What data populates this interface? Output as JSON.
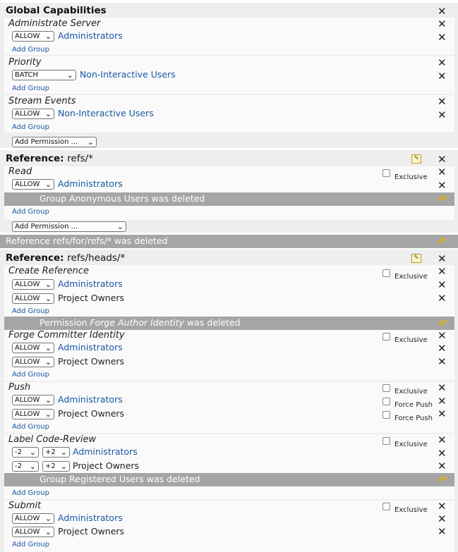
{
  "global": {
    "title": "Global Capabilities",
    "permissions": [
      {
        "name": "Administrate Server",
        "rules": [
          {
            "action": "ALLOW",
            "group": "Administrators"
          }
        ],
        "add_group": "Add Group"
      },
      {
        "name": "Priority",
        "rules": [
          {
            "action": "BATCH",
            "group": "Non-Interactive Users"
          }
        ],
        "add_group": "Add Group"
      },
      {
        "name": "Stream Events",
        "rules": [
          {
            "action": "ALLOW",
            "group": "Non-Interactive Users"
          }
        ],
        "add_group": "Add Group"
      }
    ],
    "add_permission": "Add Permission ..."
  },
  "refs_all": {
    "label": "Reference:",
    "ref": "refs/*",
    "permission": {
      "name": "Read",
      "exclusive_label": "Exclusive",
      "rules": [
        {
          "action": "ALLOW",
          "group": "Administrators"
        }
      ],
      "add_group": "Add Group"
    },
    "deleted_group": "Group Anonymous Users was deleted",
    "add_permission": "Add Permission ..."
  },
  "deleted_reference": "Reference refs/for/refs/* was deleted",
  "refs_heads": {
    "label": "Reference:",
    "ref": "refs/heads/*",
    "create_reference": {
      "name": "Create Reference",
      "exclusive_label": "Exclusive",
      "rules": [
        {
          "action": "ALLOW",
          "group": "Administrators"
        },
        {
          "action": "ALLOW",
          "group": "Project Owners"
        }
      ],
      "add_group": "Add Group"
    },
    "deleted_permission": {
      "prefix": "Permission",
      "name": "Forge Author Identity",
      "suffix": "was deleted"
    },
    "forge_committer": {
      "name": "Forge Committer Identity",
      "exclusive_label": "Exclusive",
      "rules": [
        {
          "action": "ALLOW",
          "group": "Administrators"
        },
        {
          "action": "ALLOW",
          "group": "Project Owners"
        }
      ],
      "add_group": "Add Group"
    },
    "push": {
      "name": "Push",
      "exclusive_label": "Exclusive",
      "force_push_label": "Force Push",
      "rules": [
        {
          "action": "ALLOW",
          "group": "Administrators"
        },
        {
          "action": "ALLOW",
          "group": "Project Owners"
        }
      ],
      "add_group": "Add Group"
    },
    "label_code_review": {
      "name": "Label Code-Review",
      "exclusive_label": "Exclusive",
      "rules": [
        {
          "min": "-2",
          "max": "+2",
          "group": "Administrators"
        },
        {
          "min": "-2",
          "max": "+2",
          "group": "Project Owners"
        }
      ],
      "deleted_group": "Group Registered Users was deleted",
      "add_group": "Add Group"
    },
    "submit": {
      "name": "Submit",
      "exclusive_label": "Exclusive",
      "rules": [
        {
          "action": "ALLOW",
          "group": "Administrators"
        },
        {
          "action": "ALLOW",
          "group": "Project Owners"
        }
      ],
      "add_group": "Add Group"
    }
  },
  "icons": {
    "delete": "close-icon",
    "undo": "undo-icon",
    "edit": "edit-icon"
  }
}
